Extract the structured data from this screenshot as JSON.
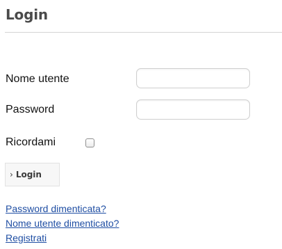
{
  "header": {
    "title": "Login"
  },
  "form": {
    "username_label": "Nome utente",
    "username_value": "",
    "password_label": "Password",
    "password_value": "",
    "remember_label": "Ricordami",
    "remember_checked": false,
    "submit_chevron": "›",
    "submit_label": "Login"
  },
  "links": {
    "forgot_password": "Password dimenticata?",
    "forgot_username": "Nome utente dimenticato?",
    "register": "Registrati"
  },
  "colors": {
    "link": "#1f4ea3",
    "title": "#4a4a4a"
  }
}
